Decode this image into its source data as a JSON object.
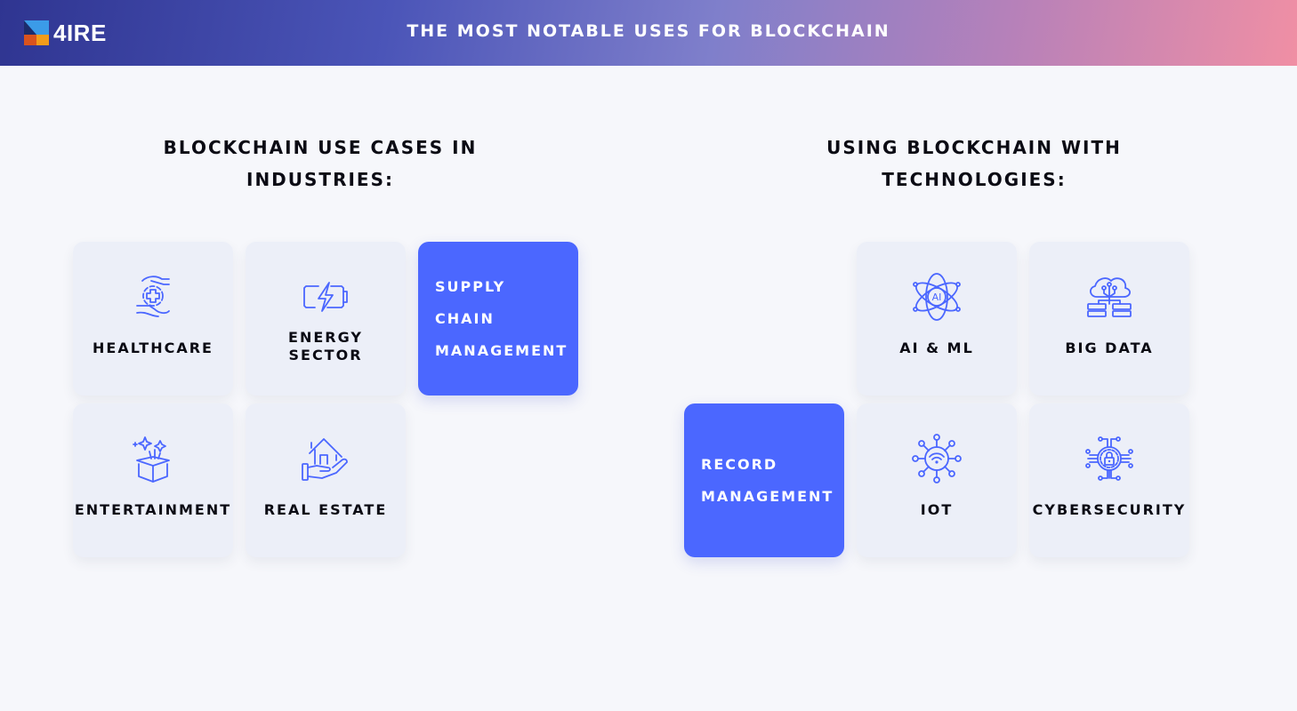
{
  "header": {
    "logo_text": "4IRE",
    "title": "THE MOST NOTABLE USES FOR BLOCKCHAIN",
    "gradient_start": "#2f3591",
    "gradient_end": "#f08fa4"
  },
  "colors": {
    "accent": "#4b67ff",
    "card_bg": "#eceff8",
    "page_bg": "#f6f7fb",
    "text": "#0b0b14"
  },
  "industries": {
    "title_line1": "BLOCKCHAIN USE CASES IN",
    "title_line2": "INDUSTRIES:",
    "cards": [
      {
        "label": "HEALTHCARE",
        "icon": "healthcare-hands-cross-icon"
      },
      {
        "label_line1": "ENERGY",
        "label_line2": "SECTOR",
        "icon": "battery-lightning-icon"
      },
      {
        "label_lines": [
          "SUPPLY",
          "CHAIN",
          "MANAGEMENT"
        ],
        "highlighted": true
      },
      {
        "label": "ENTERTAINMENT",
        "icon": "gift-box-sparkles-icon"
      },
      {
        "label": "REAL ESTATE",
        "icon": "house-in-hand-icon"
      }
    ]
  },
  "technologies": {
    "title_line1": "USING BLOCKCHAIN WITH",
    "title_line2": "TECHNOLOGIES:",
    "cards": [
      {
        "label": "AI & ML",
        "icon": "ai-atom-icon"
      },
      {
        "label": "BIG DATA",
        "icon": "cloud-database-icon"
      },
      {
        "label_lines": [
          "RECORD",
          "MANAGEMENT"
        ],
        "highlighted": true
      },
      {
        "label": "IOT",
        "icon": "iot-network-icon"
      },
      {
        "label": "CYBERSECURITY",
        "icon": "circuit-lock-icon"
      }
    ]
  }
}
